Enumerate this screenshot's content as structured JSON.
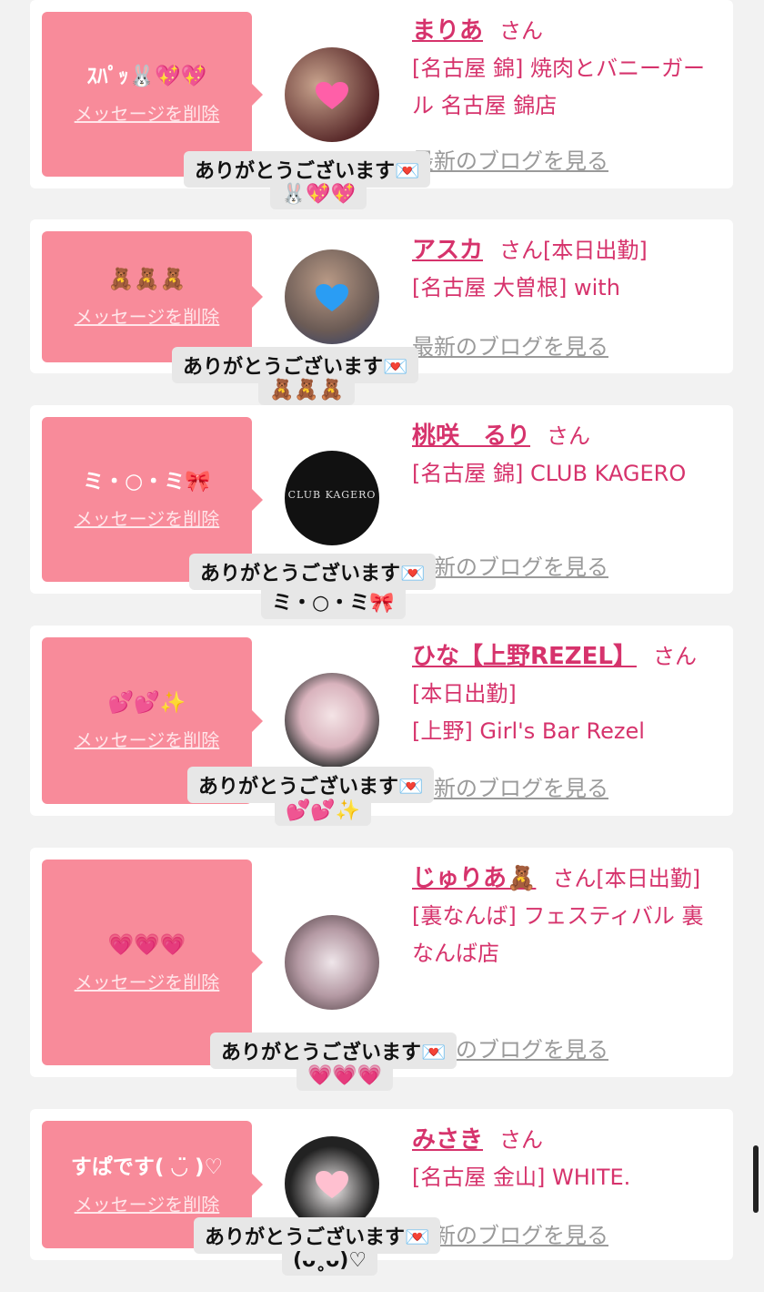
{
  "accent_color": "#d6336c",
  "bubble_color": "#f88b9a",
  "delete_label": "メッセージを削除",
  "san_label": "さん",
  "blog_label": "最新のブログを見る",
  "thanks_label": "ありがとうございます💌",
  "cards": [
    {
      "message": "ｽﾊﾟｯ🐰💖💖",
      "name": "まりあ",
      "status": "",
      "shop": "[名古屋 錦] 焼肉とバニーガール 名古屋 錦店",
      "reply": "🐰💖💖",
      "avatar_icon": "pink-heart-icon"
    },
    {
      "message": "🧸🧸🧸",
      "name": "アスカ",
      "status": "[本日出勤]",
      "shop": "[名古屋 大曽根] with",
      "reply": "🧸🧸🧸",
      "avatar_icon": "blue-heart-icon"
    },
    {
      "message": "ミ・○・ミ🎀",
      "name": "桃咲　るり",
      "status": "",
      "shop": "[名古屋 錦] CLUB KAGERO",
      "reply": "ミ・○・ミ🎀",
      "avatar_icon": "club-logo",
      "avatar_text": "CLUB KAGERO"
    },
    {
      "message": "💕💕✨",
      "name": "ひな【上野REZEL】",
      "status": "[本日出勤]",
      "shop": "[上野] Girl's Bar Rezel",
      "reply": "💕💕✨",
      "avatar_icon": "photo-avatar"
    },
    {
      "message": "💗💗💗",
      "name": "じゅりあ🧸",
      "status": "[本日出勤]",
      "shop": "[裏なんば] フェスティバル 裏なんば店",
      "reply": "💗💗💗",
      "avatar_icon": "photo-avatar"
    },
    {
      "message": "すぱです( ◡̈ )♡",
      "name": "みさき",
      "status": "",
      "shop": "[名古屋 金山] WHITE.",
      "reply": "(ᴗ˳ᴗ)♡",
      "avatar_icon": "pink-heart-icon"
    }
  ]
}
